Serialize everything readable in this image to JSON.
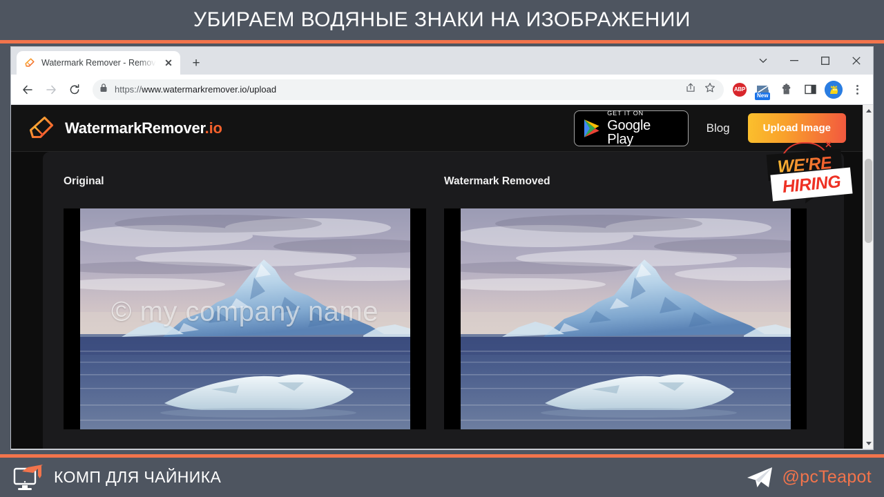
{
  "slide": {
    "title": "УБИРАЕМ ВОДЯНЫЕ ЗНАКИ НА ИЗОБРАЖЕНИИ",
    "accent_color": "#f2744c",
    "background_color": "#4e5560"
  },
  "brand_bar": {
    "logo_icon": "monitor-graduation-cap-icon",
    "name": "КОМП ДЛЯ ЧАЙНИКА",
    "telegram_icon": "telegram-plane-icon",
    "handle": "@pcTeapot",
    "handle_color": "#f2744c"
  },
  "browser": {
    "tab": {
      "favicon": "watermarkremover-eraser-favicon",
      "title": "Watermark Remover - Remove w",
      "close_label": "✕"
    },
    "new_tab_label": "+",
    "window_controls": {
      "tab_search": "tab-search-chevron",
      "minimize": "—",
      "maximize": "▢",
      "close": "✕"
    },
    "nav": {
      "back": "back-arrow",
      "forward": "forward-arrow",
      "reload": "reload-arrow"
    },
    "omnibox": {
      "lock_icon": "padlock-icon",
      "scheme": "https://",
      "url_rest": "www.watermarkremover.io/upload",
      "share_icon": "share-icon",
      "bookmark_icon": "star-icon"
    },
    "extensions": [
      {
        "name": "adblock-plus",
        "label": "ABP"
      },
      {
        "name": "screenshot-tool",
        "badge": "New"
      },
      {
        "name": "extensions-puzzle"
      },
      {
        "name": "sidepanel"
      }
    ],
    "profile_avatar": "user-avatar",
    "menu_icon": "three-dot-menu"
  },
  "site": {
    "logo_icon": "eraser-logo-icon",
    "logo_text_main": "WatermarkRemover",
    "logo_text_tld": ".io",
    "accent_color": "#f4612c",
    "google_play": {
      "icon": "google-play-triangle-icon",
      "small_text": "GET IT ON",
      "big_text": "Google Play"
    },
    "nav_links": [
      {
        "label": "Blog"
      }
    ],
    "upload_button": "Upload Image",
    "hiring_sticker": {
      "line1": "WE'RE",
      "line2": "HIRING",
      "close_label": "✕"
    }
  },
  "main": {
    "columns": [
      {
        "title": "Original",
        "has_watermark": true,
        "watermark_text": "© my company name",
        "image_alt": "iceberg-photo-watermarked"
      },
      {
        "title": "Watermark Removed",
        "has_watermark": false,
        "watermark_text": "",
        "image_alt": "iceberg-photo-clean"
      }
    ]
  }
}
